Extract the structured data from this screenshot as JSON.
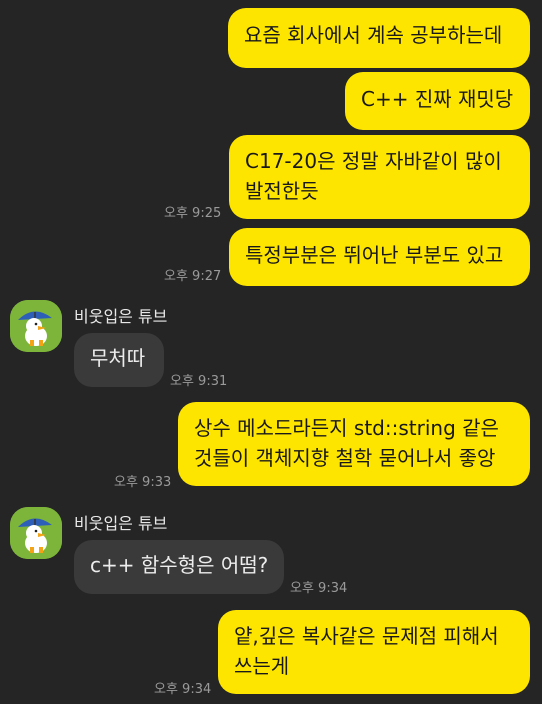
{
  "colors": {
    "background": "#252525",
    "my_bubble": "#FEE500",
    "their_bubble": "#3A3A3A"
  },
  "messages": [
    {
      "from": "me",
      "lines": [
        "요즘 회사에서 계속 공부하는데"
      ],
      "time": ""
    },
    {
      "from": "me",
      "lines": [
        "C++ 진짜 재밋당"
      ],
      "time": ""
    },
    {
      "from": "me",
      "lines": [
        "C17-20은 정말 자바같이 많이",
        "발전한듯"
      ],
      "time": "오후 9:25"
    },
    {
      "from": "me",
      "lines": [
        "특정부분은 뛰어난 부분도 있고"
      ],
      "time": "오후 9:27"
    },
    {
      "from": "them",
      "sender": "비웃입은 튜브",
      "lines": [
        "무처따"
      ],
      "time": "오후 9:31"
    },
    {
      "from": "me",
      "lines": [
        "상수 메소드라든지 std::string 같은",
        "것들이 객체지향 철학 묻어나서 좋앙"
      ],
      "time": "오후 9:33"
    },
    {
      "from": "them",
      "sender": "비웃입은 튜브",
      "lines": [
        "c++ 함수형은 어떰?"
      ],
      "time": "오후 9:34"
    },
    {
      "from": "me",
      "lines": [
        "얕,깊은 복사같은 문제점 피해서",
        "쓰는게"
      ],
      "time": "오후 9:34"
    }
  ]
}
